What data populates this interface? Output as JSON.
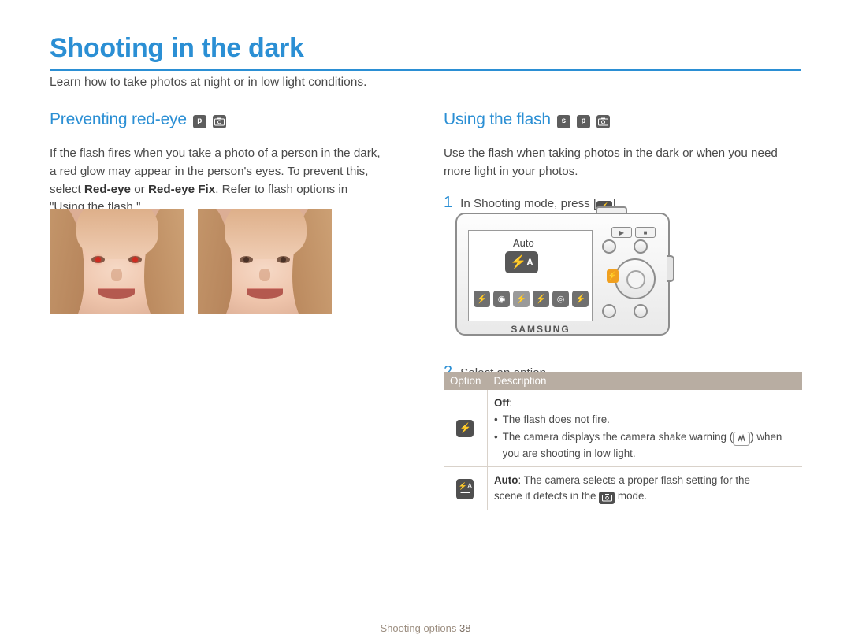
{
  "header": {
    "title": "Shooting in the dark",
    "subtitle": "Learn how to take photos at night or in low light conditions."
  },
  "left_section": {
    "heading": "Preventing red-eye",
    "badges": [
      "p",
      "camera-icon"
    ],
    "paragraph_1": "If the flash fires when you take a photo of a person in the dark,",
    "paragraph_2": "a red glow may appear in the person's eyes. To prevent this,",
    "paragraph_3_pre": "select ",
    "paragraph_3_b1": "Red-eye",
    "paragraph_3_mid": " or ",
    "paragraph_3_b2": "Red-eye Fix",
    "paragraph_3_post": ". Refer to flash options in",
    "paragraph_4": "\"Using the flash.\"",
    "image_left_caption": "photo-with-red-eye",
    "image_right_caption": "photo-without-red-eye"
  },
  "right_section": {
    "heading": "Using the flash",
    "badges": [
      "s",
      "p",
      "camera-icon"
    ],
    "paragraph_1": "Use the flash when taking photos in the dark or when you need",
    "paragraph_2": "more light in your photos.",
    "step_1_num": "1",
    "step_1_text_pre": "In Shooting mode, press [",
    "step_1_icon": "flash-icon",
    "step_1_text_post": "].",
    "step_2_num": "2",
    "step_2_text": "Select an option."
  },
  "camera": {
    "lcd_mode_label": "Auto",
    "lcd_flash_icon": "flash-auto-icon",
    "brand": "SAMSUNG",
    "option_icons": [
      "flash-off-icon",
      "red-eye-icon",
      "flash-auto-icon",
      "flash-fill-icon",
      "slow-sync-icon",
      "red-eye-fix-icon"
    ],
    "flash_key_icon": "flash-button-icon"
  },
  "table": {
    "headers": [
      "Option",
      "Description"
    ],
    "rows": [
      {
        "icon": "flash-off-icon",
        "title": "Off",
        "title_suffix": ":",
        "bullets": [
          "The flash does not fire.",
          "The camera displays the camera shake warning ( shake-icon ) when you are shooting in low light."
        ],
        "bullet_1": "The flash does not fire.",
        "bullet_2_pre": "The camera displays the camera shake warning (",
        "bullet_2_icon": "camera-shake-icon",
        "bullet_2_post": ")",
        "bullet_2_line2": "when you are shooting in low light."
      },
      {
        "icon": "flash-auto-icon",
        "title": "Auto",
        "desc_pre": ": The camera selects a proper flash setting for the",
        "desc_line2_pre": "scene it detects in the ",
        "desc_icon": "smart-auto-icon",
        "desc_line2_post": " mode."
      }
    ]
  },
  "footer": {
    "label": "Shooting options",
    "page": "38"
  },
  "colors": {
    "accent": "#2b8fd4",
    "table_header": "#b8ada2",
    "body_text": "#4a4a4a",
    "footer_text": "#9c8e80"
  }
}
